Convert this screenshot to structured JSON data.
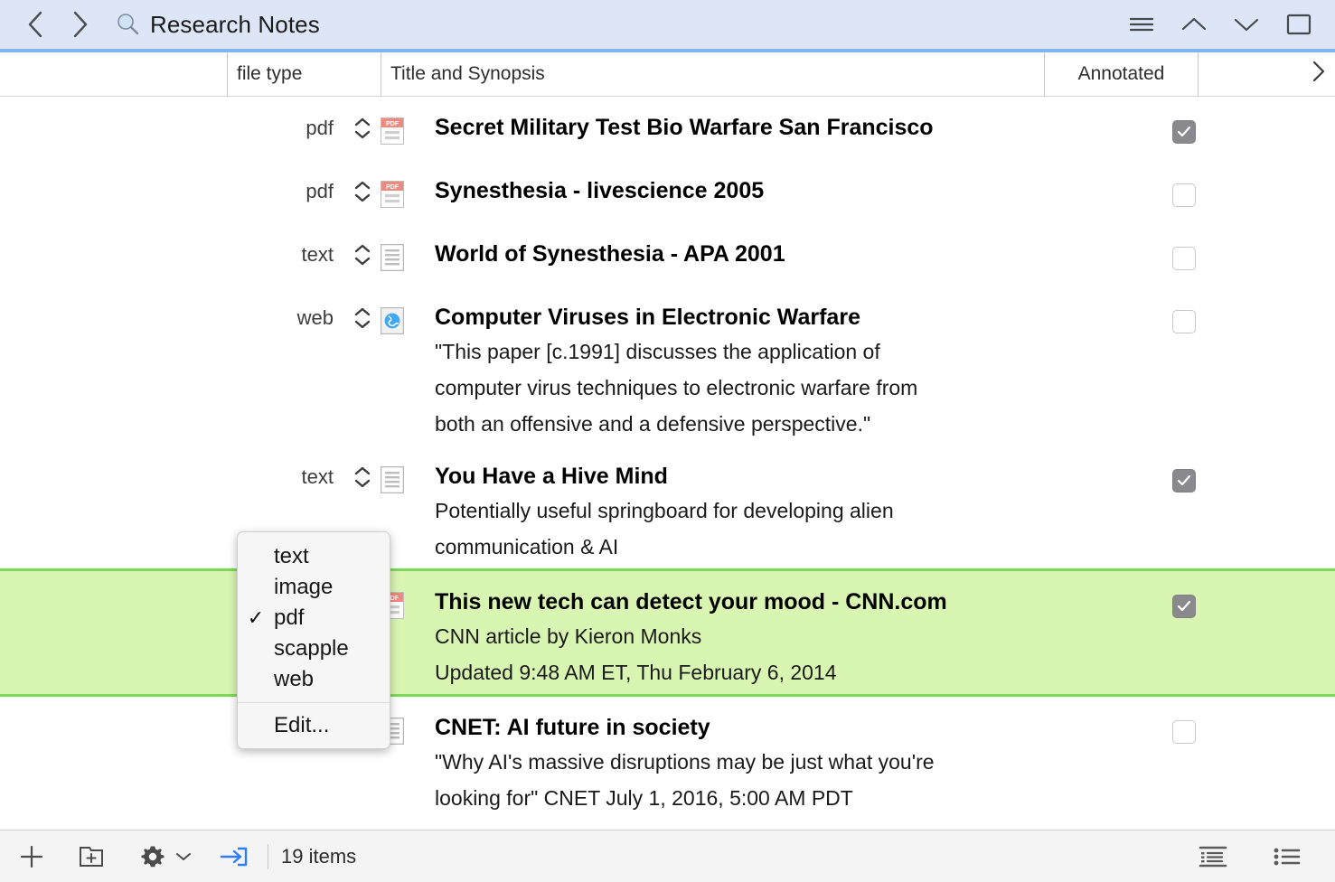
{
  "titlebar": {
    "back_icon": "chevron-left-icon",
    "forward_icon": "chevron-right-icon",
    "search_icon": "search-icon",
    "title": "Research Notes",
    "buttons": [
      {
        "name": "hamburger-menu-button",
        "icon": "hamburger-icon"
      },
      {
        "name": "previous-item-button",
        "icon": "chevron-up-icon"
      },
      {
        "name": "next-item-button",
        "icon": "chevron-down-icon"
      },
      {
        "name": "toggle-inspector-button",
        "icon": "panel-square-icon"
      }
    ]
  },
  "columns": {
    "spacer": "",
    "file_type": "file type",
    "title_synopsis": "Title and Synopsis",
    "annotated": "Annotated",
    "overflow_icon": "chevron-right-icon"
  },
  "rows": [
    {
      "file_type": "pdf",
      "icon": "pdf-file-icon",
      "title": "Secret Military Test Bio Warfare San Francisco",
      "synopsis": [],
      "annotated": true,
      "selected": false
    },
    {
      "file_type": "pdf",
      "icon": "pdf-file-icon",
      "title": "Synesthesia - livescience 2005",
      "synopsis": [],
      "annotated": false,
      "selected": false
    },
    {
      "file_type": "text",
      "icon": "text-file-icon",
      "title": "World of Synesthesia - APA 2001",
      "synopsis": [],
      "annotated": false,
      "selected": false
    },
    {
      "file_type": "web",
      "icon": "web-file-icon",
      "title": "Computer Viruses in Electronic Warfare",
      "synopsis": [
        "\"This paper [c.1991] discusses the application of",
        "computer virus techniques to electronic warfare from",
        "both an offensive and a defensive perspective.\""
      ],
      "annotated": false,
      "selected": false
    },
    {
      "file_type": "text",
      "icon": "text-file-icon",
      "title": "You Have a Hive Mind",
      "synopsis": [
        "Potentially useful springboard for developing alien",
        "communication & AI"
      ],
      "annotated": true,
      "selected": false
    },
    {
      "file_type": "",
      "icon": "pdf-file-icon",
      "title": "This new tech can detect your mood - CNN.com",
      "synopsis": [
        "CNN article by Kieron Monks",
        "Updated 9:48 AM ET, Thu February 6, 2014"
      ],
      "annotated": true,
      "selected": true
    },
    {
      "file_type": "",
      "icon": "text-file-icon",
      "title": "CNET: AI future in society",
      "synopsis": [
        "\"Why AI's massive disruptions may be just what you're",
        "looking for\" CNET July 1, 2016, 5:00 AM PDT"
      ],
      "annotated": false,
      "selected": false
    }
  ],
  "menu": {
    "items": [
      {
        "label": "text",
        "checked": false
      },
      {
        "label": "image",
        "checked": false
      },
      {
        "label": "pdf",
        "checked": true
      },
      {
        "label": "scapple",
        "checked": false
      },
      {
        "label": "web",
        "checked": false
      }
    ],
    "edit_label": "Edit...",
    "check_glyph": "✓"
  },
  "bottombar": {
    "add_icon": "plus-icon",
    "new_folder_icon": "new-folder-icon",
    "gear_icon": "gear-icon",
    "gear_chevron_icon": "chevron-down-icon",
    "import_icon": "import-arrow-icon",
    "item_count": "19 items",
    "view_outline_icon": "outline-view-icon",
    "view_list_icon": "list-view-icon"
  },
  "colors": {
    "titlebar_bg": "#dde6f6",
    "titlebar_rule": "#7eb6f7",
    "selection_green_bg": "#d9f5b2",
    "selection_green_border": "#7ed957",
    "pdf_badge": "#f08a7e",
    "web_globe": "#3fa9f5",
    "import_blue": "#2f7df6",
    "checkbox_on": "#8a8a8e"
  }
}
